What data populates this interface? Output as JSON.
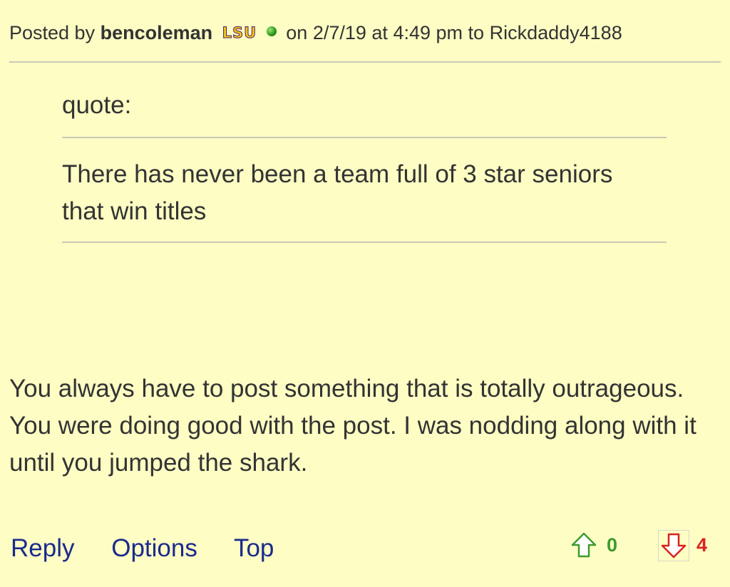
{
  "post": {
    "posted_by_prefix": "Posted by",
    "author": "bencoleman",
    "team_badge": "LSU",
    "online_status_icon": "online-dot-icon",
    "date_prefix": "on",
    "date": "2/7/19",
    "time_prefix": "at",
    "time": "4:49 pm",
    "reply_to_prefix": "to",
    "reply_to_user": "Rickdaddy4188"
  },
  "quote": {
    "label": "quote:",
    "text": "There has never been a team full of 3 star seniors that win titles"
  },
  "body": {
    "text": "You always have to post something that is totally outrageous. You were doing good with the post. I was nodding along with it until you jumped the shark."
  },
  "actions": {
    "reply": "Reply",
    "options": "Options",
    "top": "Top"
  },
  "votes": {
    "up_icon": "thumbs-up-arrow-icon",
    "up_count": "0",
    "down_icon": "thumbs-down-arrow-icon",
    "down_count": "4"
  },
  "colors": {
    "background": "#fefdc4",
    "text": "#333333",
    "link": "#1a2a8c",
    "upvote": "#3f9a2e",
    "downvote": "#d8231f",
    "rule": "#c9c9b8"
  }
}
